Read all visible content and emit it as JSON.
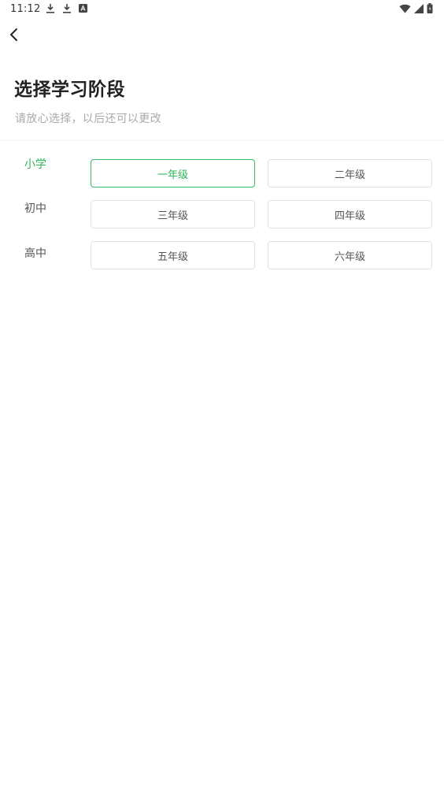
{
  "status_bar": {
    "time": "11:12",
    "left_icons": [
      "download-icon",
      "download-icon",
      "a-badge-icon"
    ],
    "right_icons": [
      "wifi-icon",
      "signal-icon",
      "battery-icon"
    ]
  },
  "header": {
    "back_icon": "chevron-left-icon",
    "title": "选择学习阶段",
    "subtitle": "请放心选择，以后还可以更改"
  },
  "stages": [
    {
      "label": "小学",
      "active": true
    },
    {
      "label": "初中",
      "active": false
    },
    {
      "label": "高中",
      "active": false
    }
  ],
  "grades": [
    {
      "label": "一年级",
      "selected": true
    },
    {
      "label": "二年级",
      "selected": false
    },
    {
      "label": "三年级",
      "selected": false
    },
    {
      "label": "四年级",
      "selected": false
    },
    {
      "label": "五年级",
      "selected": false
    },
    {
      "label": "六年级",
      "selected": false
    }
  ],
  "colors": {
    "accent": "#2db35a",
    "title": "#222222",
    "subtitle": "#aaaaaa",
    "border": "#e2e2e2"
  }
}
